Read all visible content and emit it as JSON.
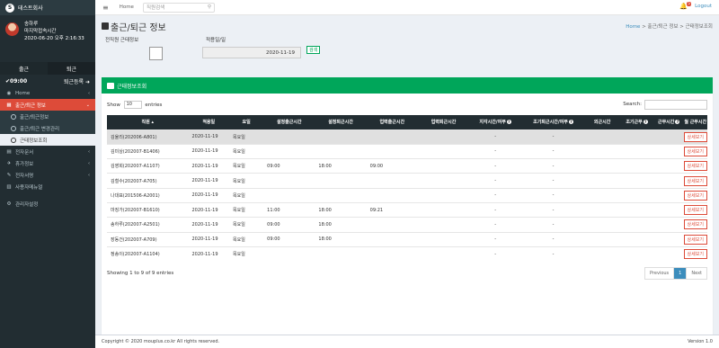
{
  "app": {
    "company": "테스트회사"
  },
  "user": {
    "name": "송하루",
    "last_access_label": "마지막접속시간",
    "last_access": "2020-06-20 오후 2:16:33"
  },
  "clock": {
    "in_label": "출근",
    "out_label": "퇴근",
    "time": "✔09:00",
    "register_label": "퇴근등록 ➜"
  },
  "sidebar": {
    "items": [
      {
        "label": "Home"
      },
      {
        "label": "출근/퇴근 정보"
      },
      {
        "label": "전자문서"
      },
      {
        "label": "휴가정보"
      },
      {
        "label": "전자서명"
      },
      {
        "label": "사용자메뉴얼"
      },
      {
        "label": "관리자설정"
      }
    ],
    "sub": [
      {
        "label": "출근/퇴근정보"
      },
      {
        "label": "출근/퇴근 변경관리"
      },
      {
        "label": "근태정보조회"
      }
    ]
  },
  "topbar": {
    "home": "Home",
    "search_placeholder": "직원검색",
    "notif_count": "5",
    "logout": "Logout"
  },
  "page": {
    "title": "출근/퇴근 정보",
    "breadcrumb": {
      "home": "Home",
      "sep": ">",
      "section": "출근/퇴근 정보",
      "current": "근태정보조회"
    }
  },
  "filter": {
    "check_label": "전직원 근태정보",
    "date_label": "적용일/일",
    "date_value": "2020-11-19",
    "search_btn": "검색"
  },
  "box": {
    "title": "근태정보조회"
  },
  "table": {
    "show": "Show",
    "length": "10",
    "entries": "entries",
    "search_label": "Search:",
    "headers": [
      "직원",
      "적용일",
      "요일",
      "설정출근시간",
      "설정퇴근시간",
      "업력출근시간",
      "업력퇴근시간",
      "지각시간/여부",
      "조기퇴근시간/여부",
      "외근시간",
      "조기근무",
      "근무시간",
      "월 근무시간"
    ],
    "rows": [
      {
        "name": "김율리(202006-A801)",
        "date": "2020-11-19",
        "day": "목요일",
        "s_in": "",
        "s_out": "",
        "r_in": "",
        "r_out": "",
        "late": "-",
        "early": "-",
        "btn": "상세보기"
      },
      {
        "name": "김미상(202007-B1406)",
        "date": "2020-11-19",
        "day": "목요일",
        "s_in": "",
        "s_out": "",
        "r_in": "",
        "r_out": "",
        "late": "-",
        "early": "-",
        "btn": "상세보기"
      },
      {
        "name": "김영희(202007-A1107)",
        "date": "2020-11-19",
        "day": "목요일",
        "s_in": "09:00",
        "s_out": "18:00",
        "r_in": "09:00",
        "r_out": "",
        "late": "-",
        "early": "-",
        "btn": "상세보기"
      },
      {
        "name": "김철수(202007-A705)",
        "date": "2020-11-19",
        "day": "목요일",
        "s_in": "",
        "s_out": "",
        "r_in": "",
        "r_out": "",
        "late": "-",
        "early": "-",
        "btn": "상세보기"
      },
      {
        "name": "나대표(201506-A2001)",
        "date": "2020-11-19",
        "day": "목요일",
        "s_in": "",
        "s_out": "",
        "r_in": "",
        "r_out": "",
        "late": "-",
        "early": "-",
        "btn": "상세보기"
      },
      {
        "name": "마징가(202007-B1610)",
        "date": "2020-11-19",
        "day": "목요일",
        "s_in": "11:00",
        "s_out": "18:00",
        "r_in": "09:21",
        "r_out": "",
        "late": "-",
        "early": "-",
        "btn": "상세보기"
      },
      {
        "name": "송하루(202007-A2501)",
        "date": "2020-11-19",
        "day": "목요일",
        "s_in": "09:00",
        "s_out": "18:00",
        "r_in": "",
        "r_out": "",
        "late": "-",
        "early": "-",
        "btn": "상세보기"
      },
      {
        "name": "장동건(202007-A709)",
        "date": "2020-11-19",
        "day": "목요일",
        "s_in": "09:00",
        "s_out": "18:00",
        "r_in": "",
        "r_out": "",
        "late": "-",
        "early": "-",
        "btn": "상세보기"
      },
      {
        "name": "정송이(202007-A1104)",
        "date": "2020-11-19",
        "day": "목요일",
        "s_in": "",
        "s_out": "",
        "r_in": "",
        "r_out": "",
        "late": "-",
        "early": "-",
        "btn": "상세보기"
      }
    ],
    "info": "Showing 1 to 9 of 9 entries",
    "pager": {
      "prev": "Previous",
      "page": "1",
      "next": "Next"
    }
  },
  "footer": {
    "copyright": "Copyright © 2020 mouplus.co.kr All rights reserved.",
    "version": "Version 1.0"
  }
}
